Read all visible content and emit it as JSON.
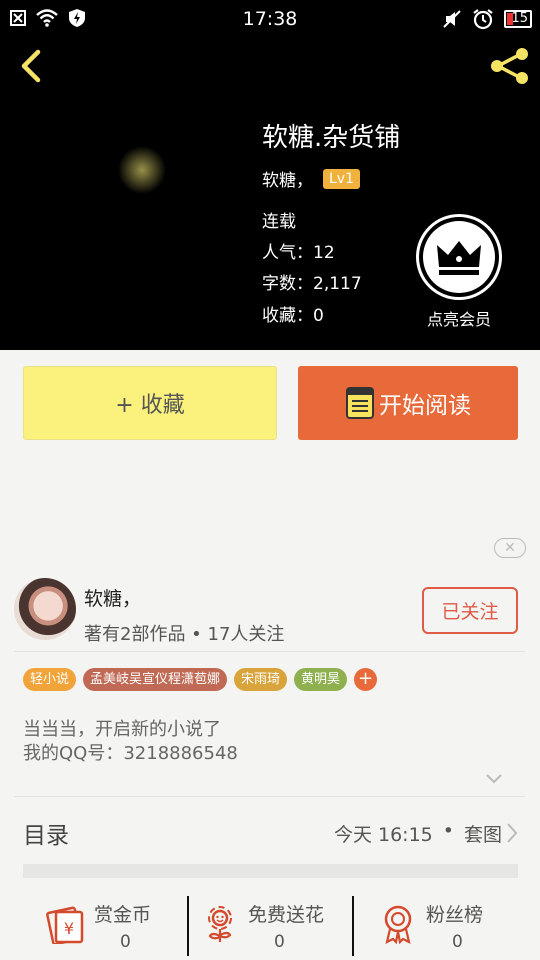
{
  "status_bar": {
    "time": "17:38",
    "battery": "15"
  },
  "book": {
    "title": "软糖.杂货铺",
    "author": "软糖，",
    "level": "Lv1",
    "status": "连载",
    "popularity": "人气：12",
    "word_count": "字数：2,117",
    "favorites": "收藏：0"
  },
  "vip": {
    "label": "点亮会员"
  },
  "actions": {
    "favorite": "+ 收藏",
    "read": "开始阅读"
  },
  "author_card": {
    "name": "软糖，",
    "stats": "著有2部作品 • 17人关注",
    "follow": "已关注"
  },
  "tags": [
    {
      "label": "轻小说",
      "color": "#f0a43a"
    },
    {
      "label": "孟美岐吴宣仪程潇苞娜",
      "color": "#c06a55"
    },
    {
      "label": "宋雨琦",
      "color": "#d9a43c"
    },
    {
      "label": "黄明昊",
      "color": "#8fb04f"
    }
  ],
  "intro": {
    "line1": "当当当，开启新的小说了",
    "line2": "我的QQ号：3218886548"
  },
  "toc": {
    "title": "目录",
    "updated": "今天 16:15",
    "dot": "•",
    "extra": "套图"
  },
  "bottom": [
    {
      "label": "赏金币",
      "value": "0",
      "icon": "money-envelope-icon"
    },
    {
      "label": "免费送花",
      "value": "0",
      "icon": "flower-icon"
    },
    {
      "label": "粉丝榜",
      "value": "0",
      "icon": "medal-icon"
    }
  ],
  "colors": {
    "accent": "#e8693a",
    "favorite_bg": "#fbf17d",
    "follow": "#e05a46",
    "icon_red": "#d44a2c"
  }
}
